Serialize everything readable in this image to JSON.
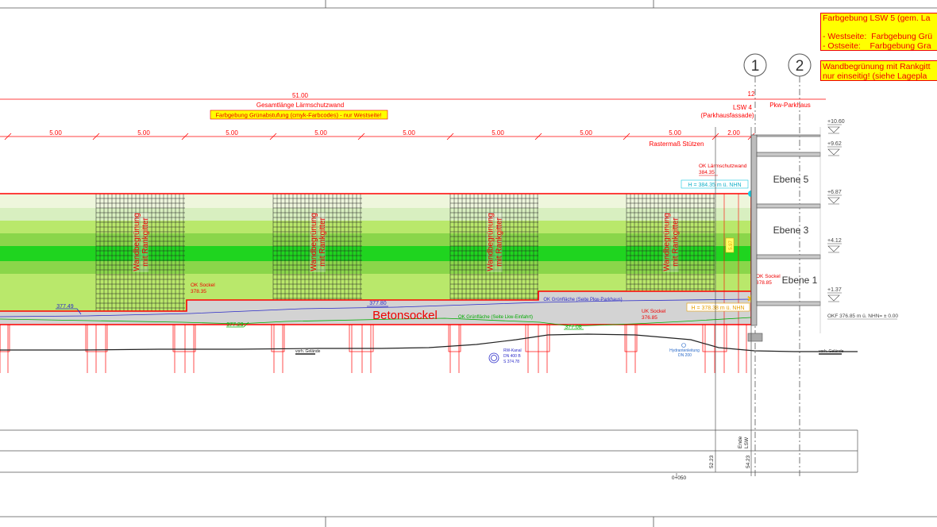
{
  "notes": {
    "color_title": "Farbgebung LSW 5 (gem. La",
    "west": "- Westseite:  Farbgebung Grü",
    "east": "- Ostseite:    Farbgebung Gra",
    "greening_1": "Wandbegrünung mit Rankgitt",
    "greening_2": "nur einseitig! (siehe Lagepla"
  },
  "axes": {
    "axis1": "1",
    "axis2": "2"
  },
  "dims": {
    "total_value": "51.00",
    "total_label": "Gesamtlänge Lärmschutzwand",
    "color_band": "Farbgebung Grünabstufung (cmyk-Farbcodes) - nur Westseite!",
    "spacing": [
      "5.00",
      "5.00",
      "5.00",
      "5.00",
      "5.00",
      "5.00",
      "5.00",
      "5.00"
    ],
    "last_spacing": "2.00",
    "raster_label": "Rastermaß Stützen",
    "lsw4_value": "12",
    "lsw4_label": "LSW 4",
    "lsw4_sub": "(Parkhausfassade)",
    "parkhaus": "Pkw-Parkhaus"
  },
  "wall": {
    "greening_line1": "Wandbegrünung",
    "greening_line2": "mit Rankgitter",
    "base_label": "Betonsockel",
    "ok_wall_label": "OK Lärmschutzwand",
    "ok_wall_value": "384.35",
    "h1": "H = 384.35 m ü. NHN",
    "h2": "H = 378.38 m ü. NHN",
    "ok_sockel_label": "OK Sockel",
    "ok_sockel_value": "378.35",
    "ok_sockel2_label": "OK Sockel",
    "ok_sockel2_value": "378.85",
    "uk_sockel_label": "UK Sockel",
    "uk_sockel_value": "376.85",
    "val_37749": "377.49",
    "val_37780": "377.80",
    "val_37729": "377.29",
    "val_37708": "377.08",
    "ok_gruen_pkw": "OK Grünfläche (Seite Pkw-Parkhaus)",
    "ok_gruen_lkw": "OK Grünfläche (Seite Lkw-Einfahrt)",
    "height_marker": "5.97"
  },
  "levels": {
    "ebene5": "Ebene 5",
    "ebene3": "Ebene 3",
    "ebene1": "Ebene 1",
    "elevations": [
      "+10.60",
      "+9.62",
      "+6.87",
      "+4.12",
      "+1.37"
    ],
    "okf": "OKF 376.85 m ü. NHN= ± 0.00"
  },
  "ground": {
    "label": "vorh. Gelände",
    "label2": "vorh. Gelände",
    "rw_kanal_1": "RW-Kanal",
    "rw_kanal_2": "DN 400 B",
    "rw_kanal_3": "S 374.78",
    "hydrant_1": "Hydrantenleitung",
    "hydrant_2": "DN 200"
  },
  "bottom": {
    "ende_1": "Ende",
    "ende_2": "LSW",
    "km_52": "52.23",
    "km_54": "54.23",
    "station": "0+050"
  },
  "colors": {
    "red": "#ff0000",
    "green_light": "#b9e86b",
    "green_mid": "#8ad64a",
    "green_bright": "#1fd41f",
    "green_dark": "#2aa82a",
    "pale": "#eef6dc",
    "base_grey": "#d3d3d3",
    "note_yellow": "#ffff00"
  }
}
